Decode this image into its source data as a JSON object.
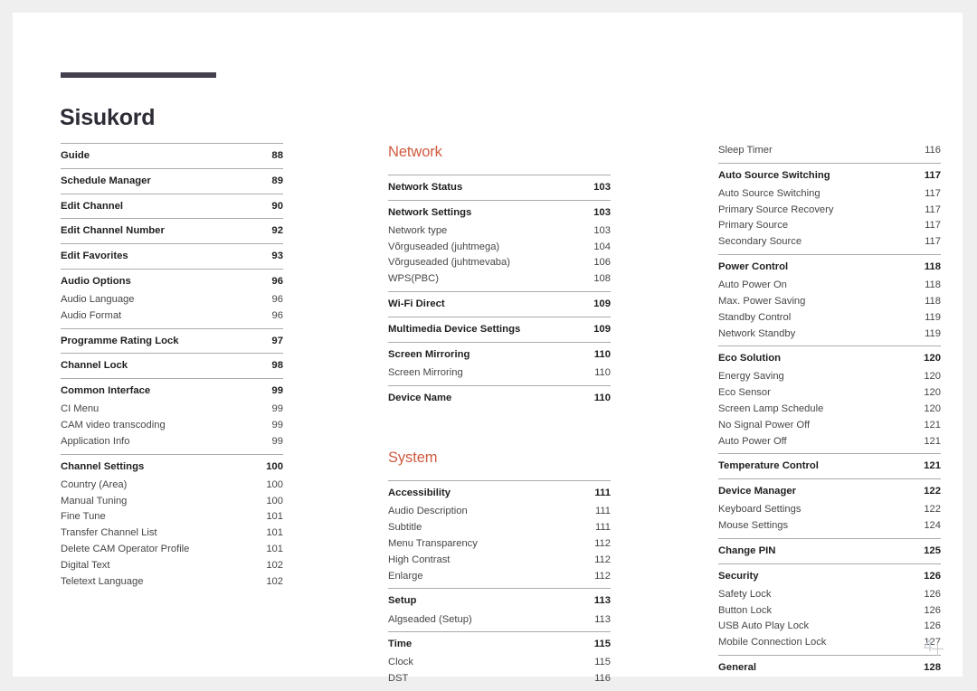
{
  "document": {
    "title": "Sisukord",
    "folio": "4"
  },
  "columns": [
    {
      "id": "column-1",
      "heading": null,
      "groups": [
        {
          "rule": true,
          "entries": [
            {
              "type": "head",
              "label": "Guide",
              "page": "88"
            }
          ]
        },
        {
          "rule": true,
          "entries": [
            {
              "type": "head",
              "label": "Schedule Manager",
              "page": "89"
            }
          ]
        },
        {
          "rule": true,
          "entries": [
            {
              "type": "head",
              "label": "Edit Channel",
              "page": "90"
            }
          ]
        },
        {
          "rule": true,
          "entries": [
            {
              "type": "head",
              "label": "Edit Channel Number",
              "page": "92"
            }
          ]
        },
        {
          "rule": true,
          "entries": [
            {
              "type": "head",
              "label": "Edit Favorites",
              "page": "93"
            }
          ]
        },
        {
          "rule": true,
          "entries": [
            {
              "type": "head",
              "label": "Audio Options",
              "page": "96"
            },
            {
              "type": "sub",
              "label": "Audio Language",
              "page": "96"
            },
            {
              "type": "sub",
              "label": "Audio Format",
              "page": "96"
            }
          ]
        },
        {
          "rule": true,
          "entries": [
            {
              "type": "head",
              "label": "Programme Rating Lock",
              "page": "97"
            }
          ]
        },
        {
          "rule": true,
          "entries": [
            {
              "type": "head",
              "label": "Channel Lock",
              "page": "98"
            }
          ]
        },
        {
          "rule": true,
          "entries": [
            {
              "type": "head",
              "label": "Common Interface",
              "page": "99"
            },
            {
              "type": "sub",
              "label": "CI Menu",
              "page": "99"
            },
            {
              "type": "sub",
              "label": "CAM video transcoding",
              "page": "99"
            },
            {
              "type": "sub",
              "label": "Application Info",
              "page": "99"
            }
          ]
        },
        {
          "rule": true,
          "entries": [
            {
              "type": "head",
              "label": "Channel Settings",
              "page": "100"
            },
            {
              "type": "sub",
              "label": "Country (Area)",
              "page": "100"
            },
            {
              "type": "sub",
              "label": "Manual Tuning",
              "page": "100"
            },
            {
              "type": "sub",
              "label": "Fine Tune",
              "page": "101"
            },
            {
              "type": "sub",
              "label": "Transfer Channel List",
              "page": "101"
            },
            {
              "type": "sub",
              "label": "Delete CAM Operator Profile",
              "page": "101"
            },
            {
              "type": "sub",
              "label": "Digital Text",
              "page": "102"
            },
            {
              "type": "sub",
              "label": "Teletext Language",
              "page": "102"
            }
          ]
        }
      ]
    },
    {
      "id": "column-2",
      "heading": "Network",
      "groups": [
        {
          "rule": true,
          "entries": [
            {
              "type": "head",
              "label": "Network Status",
              "page": "103"
            }
          ]
        },
        {
          "rule": true,
          "entries": [
            {
              "type": "head",
              "label": "Network Settings",
              "page": "103"
            },
            {
              "type": "sub",
              "label": "Network type",
              "page": "103"
            },
            {
              "type": "sub",
              "label": "Võrguseaded (juhtmega)",
              "page": "104"
            },
            {
              "type": "sub",
              "label": "Võrguseaded (juhtmevaba)",
              "page": "106"
            },
            {
              "type": "sub",
              "label": "WPS(PBC)",
              "page": "108"
            }
          ]
        },
        {
          "rule": true,
          "entries": [
            {
              "type": "head",
              "label": "Wi-Fi Direct",
              "page": "109"
            }
          ]
        },
        {
          "rule": true,
          "entries": [
            {
              "type": "head",
              "label": "Multimedia Device Settings",
              "page": "109"
            }
          ]
        },
        {
          "rule": true,
          "entries": [
            {
              "type": "head",
              "label": "Screen Mirroring",
              "page": "110"
            },
            {
              "type": "sub",
              "label": "Screen Mirroring",
              "page": "110"
            }
          ]
        },
        {
          "rule": true,
          "entries": [
            {
              "type": "head",
              "label": "Device Name",
              "page": "110"
            }
          ]
        }
      ],
      "heading2": "System",
      "groups2": [
        {
          "rule": true,
          "entries": [
            {
              "type": "head",
              "label": "Accessibility",
              "page": "111"
            },
            {
              "type": "sub",
              "label": "Audio Description",
              "page": "111"
            },
            {
              "type": "sub",
              "label": "Subtitle",
              "page": "111"
            },
            {
              "type": "sub",
              "label": "Menu Transparency",
              "page": "112"
            },
            {
              "type": "sub",
              "label": "High Contrast",
              "page": "112"
            },
            {
              "type": "sub",
              "label": "Enlarge",
              "page": "112"
            }
          ]
        },
        {
          "rule": true,
          "entries": [
            {
              "type": "head",
              "label": "Setup",
              "page": "113"
            },
            {
              "type": "sub",
              "label": "Algseaded (Setup)",
              "page": "113"
            }
          ]
        },
        {
          "rule": true,
          "entries": [
            {
              "type": "head",
              "label": "Time",
              "page": "115"
            },
            {
              "type": "sub",
              "label": "Clock",
              "page": "115"
            },
            {
              "type": "sub",
              "label": "DST",
              "page": "116"
            }
          ]
        }
      ]
    },
    {
      "id": "column-3",
      "heading": null,
      "groups": [
        {
          "rule": false,
          "entries": [
            {
              "type": "sub",
              "label": "Sleep Timer",
              "page": "116"
            }
          ]
        },
        {
          "rule": true,
          "entries": [
            {
              "type": "head",
              "label": "Auto Source Switching",
              "page": "117"
            },
            {
              "type": "sub",
              "label": "Auto Source Switching",
              "page": "117"
            },
            {
              "type": "sub",
              "label": "Primary Source Recovery",
              "page": "117"
            },
            {
              "type": "sub",
              "label": "Primary Source",
              "page": "117"
            },
            {
              "type": "sub",
              "label": "Secondary Source",
              "page": "117"
            }
          ]
        },
        {
          "rule": true,
          "entries": [
            {
              "type": "head",
              "label": "Power Control",
              "page": "118"
            },
            {
              "type": "sub",
              "label": "Auto Power On",
              "page": "118"
            },
            {
              "type": "sub",
              "label": "Max. Power Saving",
              "page": "118"
            },
            {
              "type": "sub",
              "label": "Standby Control",
              "page": "119"
            },
            {
              "type": "sub",
              "label": "Network Standby",
              "page": "119"
            }
          ]
        },
        {
          "rule": true,
          "entries": [
            {
              "type": "head",
              "label": "Eco Solution",
              "page": "120"
            },
            {
              "type": "sub",
              "label": "Energy Saving",
              "page": "120"
            },
            {
              "type": "sub",
              "label": "Eco Sensor",
              "page": "120"
            },
            {
              "type": "sub",
              "label": "Screen Lamp Schedule",
              "page": "120"
            },
            {
              "type": "sub",
              "label": "No Signal Power Off",
              "page": "121"
            },
            {
              "type": "sub",
              "label": "Auto Power Off",
              "page": "121"
            }
          ]
        },
        {
          "rule": true,
          "entries": [
            {
              "type": "head",
              "label": "Temperature Control",
              "page": "121"
            }
          ]
        },
        {
          "rule": true,
          "entries": [
            {
              "type": "head",
              "label": "Device Manager",
              "page": "122"
            },
            {
              "type": "sub",
              "label": "Keyboard Settings",
              "page": "122"
            },
            {
              "type": "sub",
              "label": "Mouse Settings",
              "page": "124"
            }
          ]
        },
        {
          "rule": true,
          "entries": [
            {
              "type": "head",
              "label": "Change PIN",
              "page": "125"
            }
          ]
        },
        {
          "rule": true,
          "entries": [
            {
              "type": "head",
              "label": "Security",
              "page": "126"
            },
            {
              "type": "sub",
              "label": "Safety Lock",
              "page": "126"
            },
            {
              "type": "sub",
              "label": "Button Lock",
              "page": "126"
            },
            {
              "type": "sub",
              "label": "USB Auto Play Lock",
              "page": "126"
            },
            {
              "type": "sub",
              "label": "Mobile Connection Lock",
              "page": "127"
            }
          ]
        },
        {
          "rule": true,
          "entries": [
            {
              "type": "head",
              "label": "General",
              "page": "128"
            }
          ]
        }
      ]
    }
  ],
  "colors": {
    "section_heading": "#cf5b40",
    "title_rule": "#433f4d",
    "separator": "#aaaaaa",
    "folio": "#cdd2d6"
  }
}
